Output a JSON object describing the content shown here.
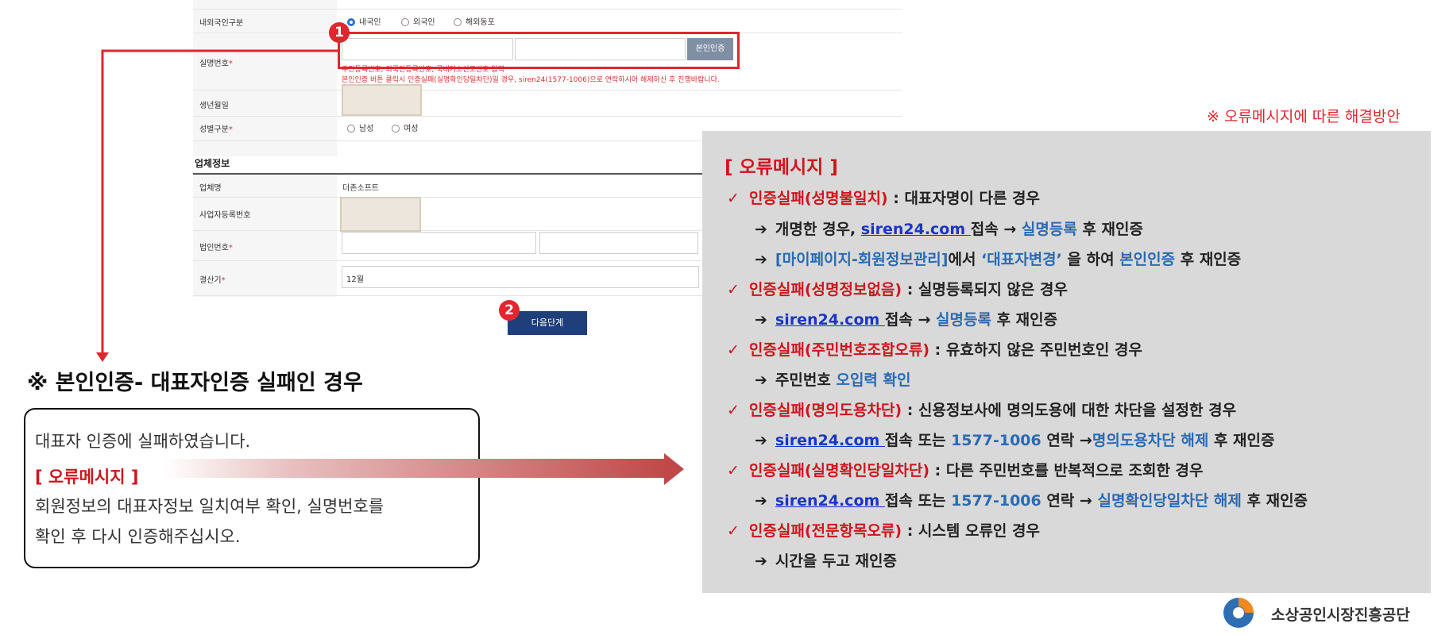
{
  "form": {
    "rows": {
      "nationality": {
        "label": "내외국인구분",
        "options": [
          "내국인",
          "외국인",
          "해외동포"
        ],
        "selected": "내국인"
      },
      "resident_number": {
        "label": "실명번호",
        "required_mark": "*",
        "button": "본인인증",
        "hint1": "주민등록번호, 외국인등록번호, 국내거소신고번호 입력",
        "hint2": "본인인증 버튼 클릭시 인증실패(실명확인당일차단)일 경우, siren24(1577-1006)으로 연락하시어 해제하신 후 진행바랍니다."
      },
      "birthdate": {
        "label": "생년월일"
      },
      "gender": {
        "label": "성별구분",
        "required_mark": "*",
        "options": [
          "남성",
          "여성"
        ]
      }
    },
    "company_section_title": "업체정보",
    "company": {
      "name": {
        "label": "업체명",
        "value": "더존소프트"
      },
      "business_number": {
        "label": "사업자등록번호"
      },
      "corp_number": {
        "label": "법인번호",
        "required_mark": "*"
      },
      "fiscal_month": {
        "label": "결산기",
        "required_mark": "*",
        "value": "12월"
      }
    },
    "next_button": "다음단계",
    "badges": [
      "1",
      "2"
    ]
  },
  "left_callout": {
    "heading": "※ 본인인증- 대표자인증 실패인 경우",
    "line1": "대표자 인증에 실패하였습니다.",
    "error_title": "[ 오류메시지 ]",
    "line2": "회원정보의 대표자정보 일치여부 확인, 실명번호를",
    "line3": "확인 후 다시 인증해주십시오."
  },
  "right_panel": {
    "caption": "※ 오류메시지에 따른 해결방안",
    "title": "[ 오류메시지 ]",
    "items": [
      {
        "t1": "인증실패(성명불일치)",
        "t2": " : 대표자명이 다른 경우"
      },
      {
        "t1": "인증실패(성명정보없음)",
        "t2": " : 실명등록되지 않은 경우"
      },
      {
        "t1": "인증실패(주민번호조합오류)",
        "t2": " : 유효하지 않은 주민번호인 경우"
      },
      {
        "t1": "인증실패(명의도용차단)",
        "t2": " :  신용정보사에 명의도용에 대한 차단을 설정한 경우"
      },
      {
        "t1": "인증실패(실명확인당일차단)",
        "t2": " : 다른 주민번호를 반복적으로 조회한 경우"
      },
      {
        "t1": "인증실패(전문항목오류)",
        "t2": " : 시스템 오류인 경우"
      }
    ],
    "sub": {
      "a1": "개명한 경우, ",
      "a2": "siren24.com ",
      "a3": "접속 ",
      "a4": "→ ",
      "a5": "실명등록",
      "a6": " 후 재인증",
      "b1": "[마이페이지-회원정보관리]",
      "b2": "에서 ",
      "b3": "‘대표자변경’",
      "b4": " 을 하여 ",
      "b5": "본인인증",
      "b6": " 후 재인증",
      "c1": "siren24.com ",
      "c2": "접속 → ",
      "c3": "실명등록",
      "c4": " 후 재인증",
      "d1": "주민번호 ",
      "d2": "오입력 확인",
      "e1": "siren24.com ",
      "e2": "접속 또는 ",
      "e3": "1577-1006",
      "e4": " 연락 →",
      "e5": "명의도용차단 해제",
      "e6": " 후 재인증",
      "f1": "siren24.com ",
      "f2": "접속 또는 ",
      "f3": "1577-1006",
      "f4": " 연락 → ",
      "f5": "실명확인당일차단 해제",
      "f6": " 후 재인증",
      "g1": "시간을 두고 재인증"
    },
    "check_mark": "✓",
    "arrow_mark": "➔"
  },
  "logo_text": "소상공인시장진흥공단",
  "colors": {
    "accent_red": "#d0141c",
    "accent_blue": "#2a6ab4",
    "button_navy": "#1f3f7a",
    "panel_bg": "#d9d9d9"
  }
}
